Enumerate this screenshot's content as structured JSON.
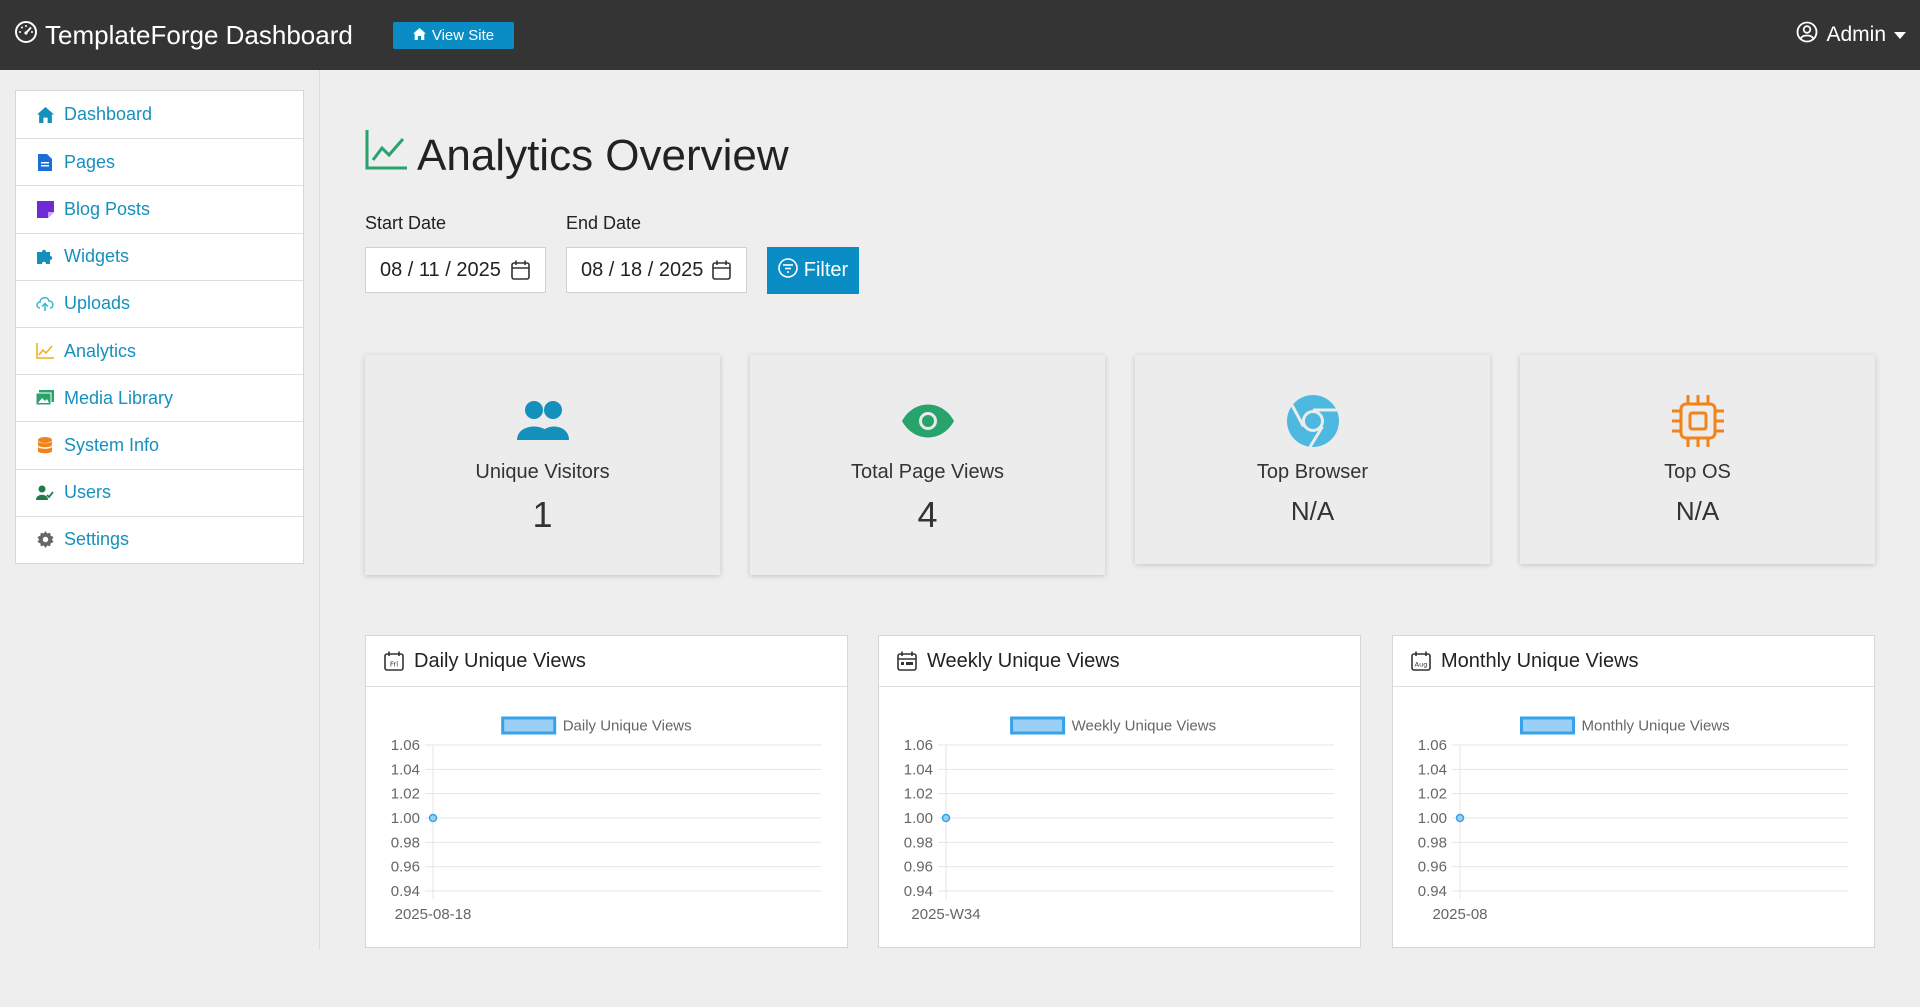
{
  "header": {
    "brand": "TemplateForge Dashboard",
    "view_site_label": "View Site",
    "user_label": "Admin"
  },
  "sidebar": {
    "items": [
      {
        "label": "Dashboard",
        "icon": "home-icon",
        "color": "#1590bd"
      },
      {
        "label": "Pages",
        "icon": "file-icon",
        "color": "#1a6fd6"
      },
      {
        "label": "Blog Posts",
        "icon": "sticky-note-icon",
        "color": "#6f2ad6"
      },
      {
        "label": "Widgets",
        "icon": "puzzle-icon",
        "color": "#1590bd"
      },
      {
        "label": "Uploads",
        "icon": "cloud-upload-icon",
        "color": "#35b5c9"
      },
      {
        "label": "Analytics",
        "icon": "line-chart-icon",
        "color": "#f0ad1a"
      },
      {
        "label": "Media Library",
        "icon": "image-icon",
        "color": "#27a36b"
      },
      {
        "label": "System Info",
        "icon": "database-icon",
        "color": "#f0841a"
      },
      {
        "label": "Users",
        "icon": "user-check-icon",
        "color": "#1f7a4a"
      },
      {
        "label": "Settings",
        "icon": "gear-icon",
        "color": "#666666"
      }
    ]
  },
  "main": {
    "title": "Analytics Overview",
    "start_date_label": "Start Date",
    "start_date_value": "08 / 11 / 2025",
    "end_date_label": "End Date",
    "end_date_value": "08 / 18 / 2025",
    "filter_label": "Filter"
  },
  "stats": [
    {
      "label": "Unique Visitors",
      "value": "1",
      "icon": "users-icon",
      "color": "#1590bd"
    },
    {
      "label": "Total Page Views",
      "value": "4",
      "icon": "eye-icon",
      "color": "#27a36b"
    },
    {
      "label": "Top Browser",
      "value": "N/A",
      "icon": "chrome-icon",
      "color": "#4db8e0"
    },
    {
      "label": "Top OS",
      "value": "N/A",
      "icon": "cpu-icon",
      "color": "#f0841a"
    }
  ],
  "chart_data": [
    {
      "type": "line",
      "title": "Daily Unique Views",
      "icon": "calendar-day-icon",
      "icon_text": "Fri",
      "series": [
        {
          "name": "Daily Unique Views",
          "values": [
            1
          ]
        }
      ],
      "categories": [
        "2025-08-18"
      ],
      "ylim": [
        0.94,
        1.06
      ],
      "yticks": [
        "1.06",
        "1.04",
        "1.02",
        "1.00",
        "0.98",
        "0.96",
        "0.94"
      ],
      "legend": "top-center",
      "grid": true
    },
    {
      "type": "line",
      "title": "Weekly Unique Views",
      "icon": "calendar-week-icon",
      "icon_text": "",
      "series": [
        {
          "name": "Weekly Unique Views",
          "values": [
            1
          ]
        }
      ],
      "categories": [
        "2025-W34"
      ],
      "ylim": [
        0.94,
        1.06
      ],
      "yticks": [
        "1.06",
        "1.04",
        "1.02",
        "1.00",
        "0.98",
        "0.96",
        "0.94"
      ],
      "legend": "top-center",
      "grid": true
    },
    {
      "type": "line",
      "title": "Monthly Unique Views",
      "icon": "calendar-month-icon",
      "icon_text": "Aug",
      "series": [
        {
          "name": "Monthly Unique Views",
          "values": [
            1
          ]
        }
      ],
      "categories": [
        "2025-08"
      ],
      "ylim": [
        0.94,
        1.06
      ],
      "yticks": [
        "1.06",
        "1.04",
        "1.02",
        "1.00",
        "0.98",
        "0.96",
        "0.94"
      ],
      "legend": "top-center",
      "grid": true
    }
  ],
  "colors": {
    "topbar": "#343434",
    "accent": "#0a8cc4",
    "chart_line": "#36a2eb",
    "chart_fill": "#9ad0f5"
  }
}
